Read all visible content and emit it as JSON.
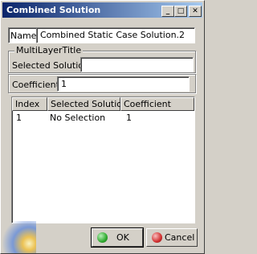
{
  "window": {
    "title": "Combined Solution",
    "minimize_glyph": "_",
    "maximize_glyph": "□",
    "close_glyph": "✕"
  },
  "name": {
    "label": "Name",
    "value": "Combined Static Case Solution.2"
  },
  "multilayer": {
    "title": "MultiLayerTitle",
    "selected_solution_label": "Selected Solution",
    "selected_solution_value": ""
  },
  "coefficient": {
    "label": "Coefficient",
    "value": "1"
  },
  "table": {
    "columns": [
      "Index",
      "Selected Solution",
      "Coefficient"
    ],
    "rows": [
      {
        "index": "1",
        "solution": "No Selection",
        "coefficient": "1"
      }
    ]
  },
  "buttons": {
    "ok_label": "OK",
    "cancel_label": "Cancel",
    "ok_color": "#2faa2f",
    "cancel_color": "#d23030"
  }
}
